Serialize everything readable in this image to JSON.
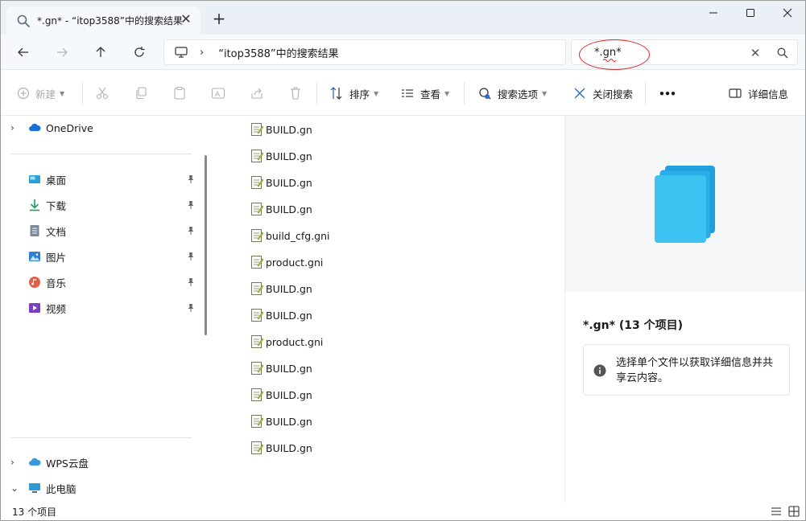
{
  "titlebar": {
    "tab_title": "*.gn* - “itop3588”中的搜索结果",
    "new_tab_icon": "plus-icon",
    "minimize_icon": "minimize-icon",
    "maximize_icon": "maximize-icon",
    "close_icon": "close-icon"
  },
  "addressbar": {
    "breadcrumb": "“itop3588”中的搜索结果",
    "search_value": "*.gn*"
  },
  "commandbar": {
    "new_label": "新建",
    "sort_label": "排序",
    "view_label": "查看",
    "search_options_label": "搜索选项",
    "close_search_label": "关闭搜索",
    "more_label": "•••",
    "details_label": "详细信息"
  },
  "sidebar": {
    "onedrive": "OneDrive",
    "quick_access": [
      {
        "label": "桌面",
        "icon": "desktop-icon"
      },
      {
        "label": "下载",
        "icon": "download-icon"
      },
      {
        "label": "文档",
        "icon": "documents-icon"
      },
      {
        "label": "图片",
        "icon": "pictures-icon"
      },
      {
        "label": "音乐",
        "icon": "music-icon"
      },
      {
        "label": "视频",
        "icon": "videos-icon"
      }
    ],
    "wps": "WPS云盘",
    "this_pc": "此电脑"
  },
  "files": [
    "BUILD.gn",
    "BUILD.gn",
    "BUILD.gn",
    "BUILD.gn",
    "build_cfg.gni",
    "product.gni",
    "BUILD.gn",
    "BUILD.gn",
    "product.gni",
    "BUILD.gn",
    "BUILD.gn",
    "BUILD.gn",
    "BUILD.gn"
  ],
  "details": {
    "title": "*.gn* (13 个项目)",
    "info_text": "选择单个文件以获取详细信息并共享云内容。"
  },
  "status": {
    "count": "13 个项目"
  },
  "colors": {
    "titlebar_bg": "#eaf0f6",
    "accent_blue": "#1a73c8",
    "annotation_red": "#dd2222"
  }
}
